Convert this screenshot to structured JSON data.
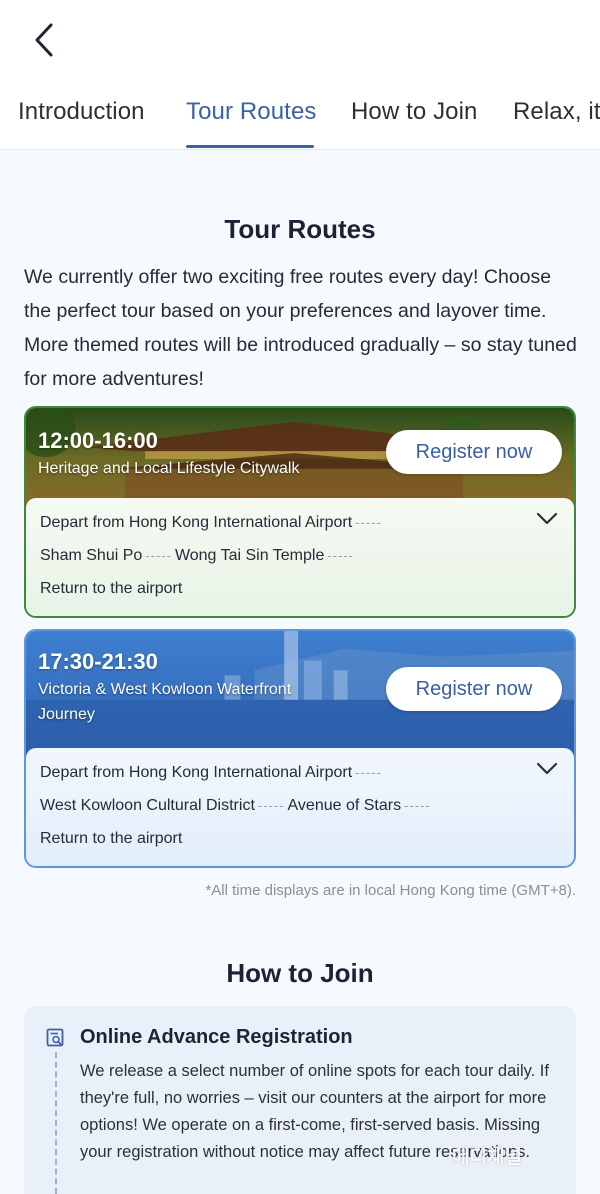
{
  "tabs": [
    {
      "label": "Introduction"
    },
    {
      "label": "Tour Routes"
    },
    {
      "label": "How to Join"
    },
    {
      "label": "Relax, it'"
    }
  ],
  "active_tab": "Tour Routes",
  "tour_routes": {
    "title": "Tour Routes",
    "intro": "We currently offer two exciting free routes every day! Choose the perfect tour based on your preferences and layover time. More themed routes will be introduced gradually – so stay tuned for more adventures!",
    "routes": [
      {
        "time": "12:00-16:00",
        "name": "Heritage and Local Lifestyle Citywalk",
        "register_label": "Register now",
        "stops": [
          [
            "Depart from Hong Kong International Airport"
          ],
          [
            "Sham Shui Po",
            "Wong Tai Sin Temple"
          ],
          [
            "Return to the airport"
          ]
        ]
      },
      {
        "time": "17:30-21:30",
        "name": "Victoria & West Kowloon Waterfront Journey",
        "register_label": "Register now",
        "stops": [
          [
            "Depart from Hong Kong International Airport"
          ],
          [
            "West Kowloon Cultural District",
            "Avenue of Stars"
          ],
          [
            "Return to the airport"
          ]
        ]
      }
    ],
    "footnote": "*All time displays are in local Hong Kong time (GMT+8)."
  },
  "how_to_join": {
    "title": "How to Join",
    "step_title": "Online Advance Registration",
    "step_text": "We release a select number of online spots for each tour daily. If they're full, no worries – visit our counters at the airport for more options! We operate on a first-come, first-served basis. Missing your registration without notice may affect future reservations."
  },
  "watermark": "메디채널",
  "colors": {
    "accent": "#3a62a7",
    "green_border": "#3e8a3b",
    "blue_border": "#5f97dd"
  }
}
